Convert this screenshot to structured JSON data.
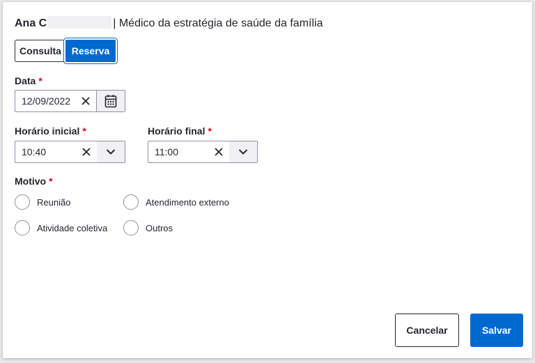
{
  "header": {
    "name": "Ana C",
    "separator": "|",
    "role": "Médico da estratégia de saúde da família"
  },
  "toggle": {
    "consulta_label": "Consulta",
    "reserva_label": "Reserva",
    "selected": "Reserva"
  },
  "form": {
    "data": {
      "label": "Data",
      "required": "*",
      "value": "12/09/2022"
    },
    "horario_inicial": {
      "label": "Horário inicial",
      "required": "*",
      "value": "10:40"
    },
    "horario_final": {
      "label": "Horário final",
      "required": "*",
      "value": "11:00"
    },
    "motivo": {
      "label": "Motivo",
      "required": "*",
      "options": [
        "Reunião",
        "Atendimento externo",
        "Atividade coletiva",
        "Outros"
      ],
      "selected": null
    }
  },
  "footer": {
    "cancel_label": "Cancelar",
    "save_label": "Salvar"
  },
  "colors": {
    "primary": "#0069d0",
    "required": "#d0021b",
    "text": "#24252e",
    "border": "#8f8fa2"
  },
  "icons": {
    "clear": "close-icon",
    "calendar": "calendar-icon",
    "dropdown": "chevron-down-icon"
  }
}
